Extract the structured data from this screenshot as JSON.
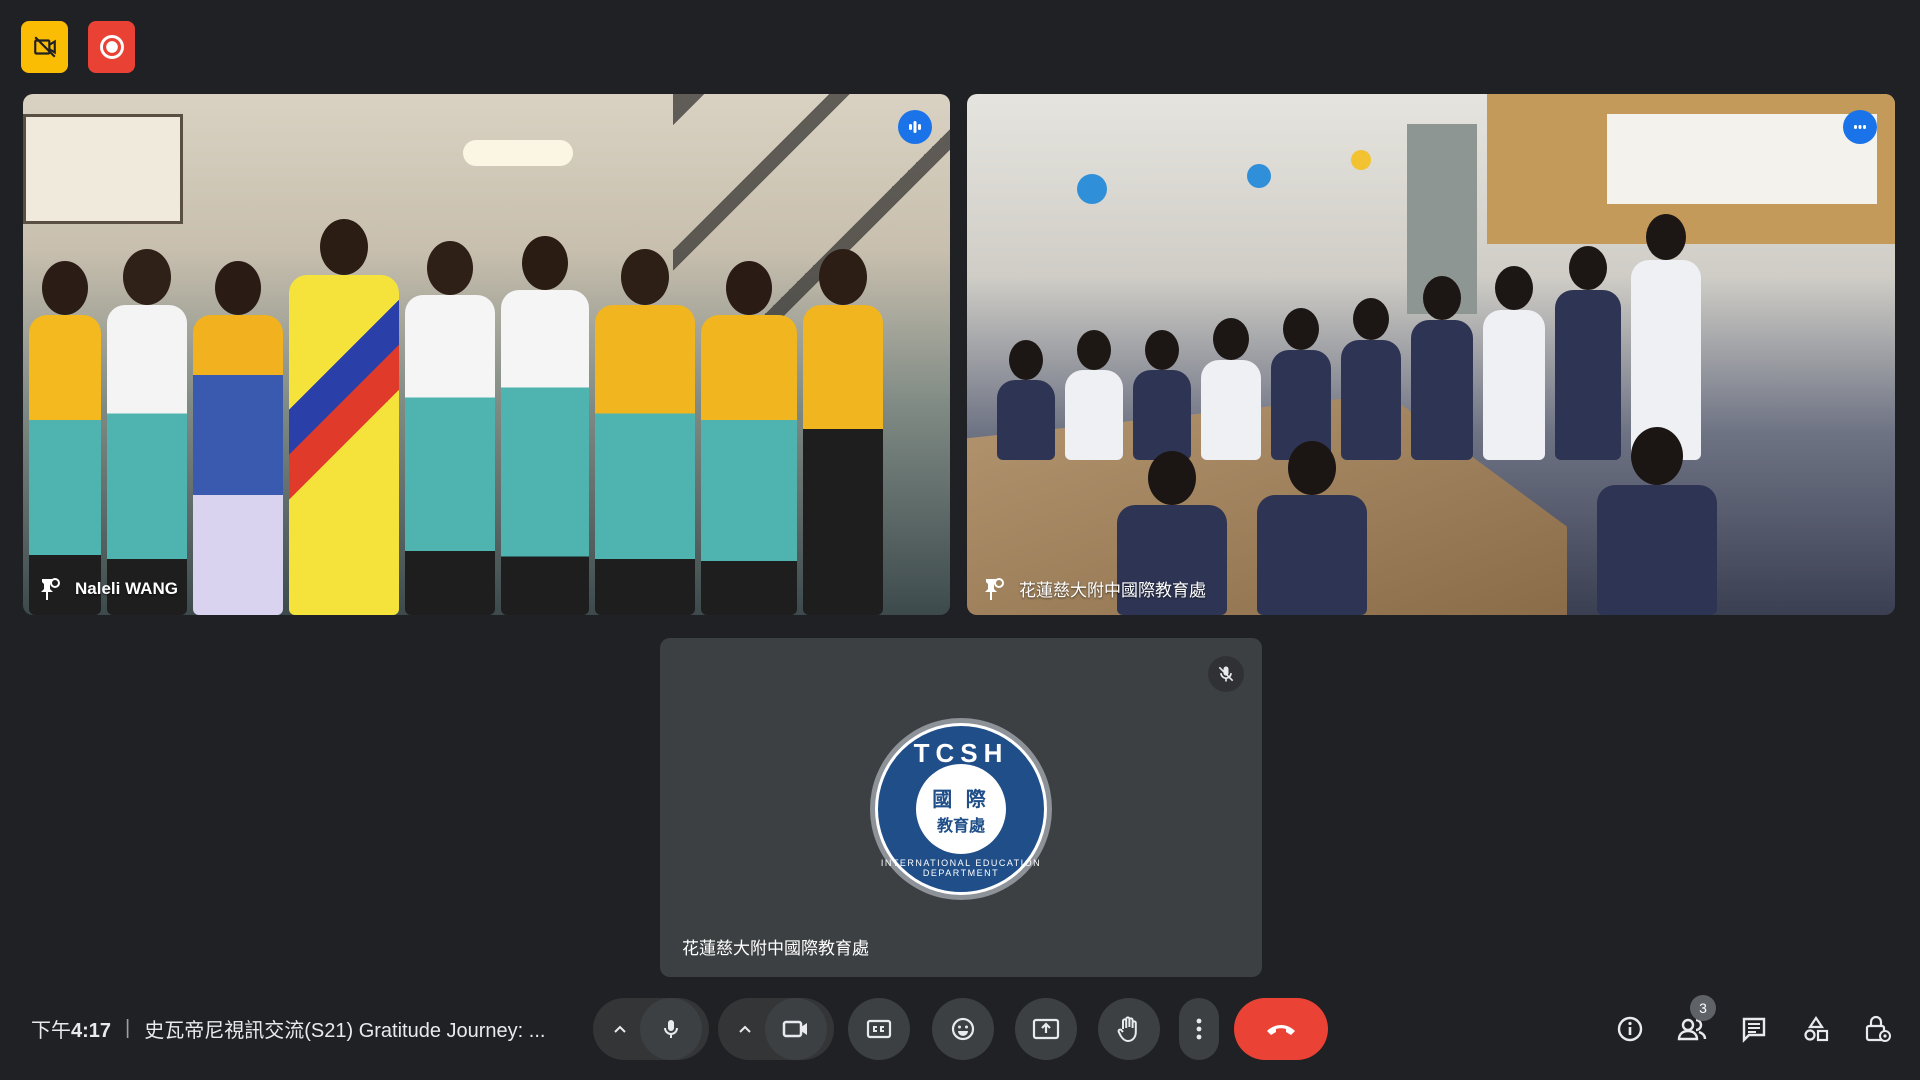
{
  "participants": [
    {
      "name": "Naleli WANG"
    },
    {
      "name": "花蓮慈大附中國際教育處"
    },
    {
      "name": "花蓮慈大附中國際教育處",
      "avatar": {
        "top_text": "TCSH",
        "core_line1": "國 際",
        "core_line2": "教育處",
        "ring_text": "INTERNATIONAL EDUCATION DEPARTMENT"
      }
    }
  ],
  "meeting": {
    "time_prefix": "下午",
    "time": "4:17",
    "separator": "|",
    "title": "史瓦帝尼視訊交流(S21) Gratitude Journey: ..."
  },
  "people_count": "3",
  "colors": {
    "background": "#202124",
    "end_call": "#ea4335",
    "speaking": "#1a73e8",
    "recording": "#e94235",
    "badge_yellow": "#fbbc04"
  },
  "icons": [
    "no-cam-badge-icon",
    "recording-icon",
    "microphone-icon",
    "camera-icon",
    "captions-icon",
    "emoji-icon",
    "present-icon",
    "raise-hand-icon",
    "more-options-icon",
    "end-call-icon",
    "info-icon",
    "people-icon",
    "chat-icon",
    "activities-icon",
    "host-controls-icon"
  ]
}
